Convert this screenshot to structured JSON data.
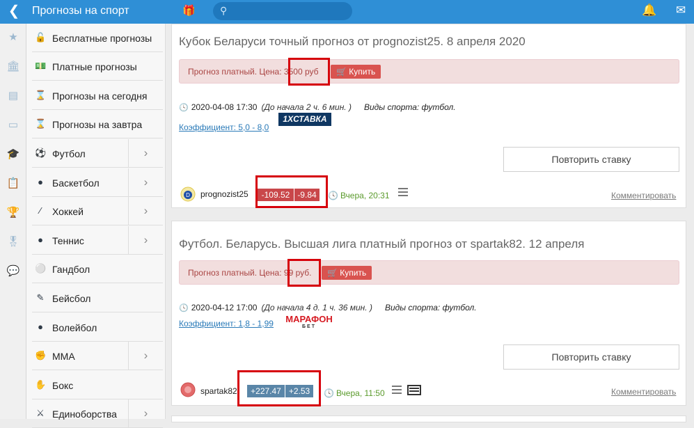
{
  "header": {
    "back_icon": "chevron-left-icon",
    "title": "Прогнозы на спорт",
    "gift_icon": "gift-icon",
    "search_icon": "search-icon",
    "search_placeholder": "",
    "notifications_icon": "bell-warning-icon",
    "mail_icon": "envelope-icon"
  },
  "icon_rail": [
    "star-icon",
    "bank-icon",
    "newspaper-icon",
    "monitor-icon",
    "graduation-cap-icon",
    "clipboard-icon",
    "trophy-icon",
    "medal-icon",
    "chat-icon"
  ],
  "menu": {
    "items": [
      {
        "label": "Бесплатные прогнозы",
        "icon": "unlock-icon",
        "has_submenu": false
      },
      {
        "label": "Платные прогнозы",
        "icon": "money-icon",
        "has_submenu": false
      },
      {
        "label": "Прогнозы на сегодня",
        "icon": "hourglass-icon",
        "has_submenu": false
      },
      {
        "label": "Прогнозы на завтра",
        "icon": "hourglass-icon",
        "has_submenu": false
      },
      {
        "label": "Футбол",
        "icon": "soccer-ball-icon",
        "has_submenu": true
      },
      {
        "label": "Баскетбол",
        "icon": "basketball-icon",
        "has_submenu": true
      },
      {
        "label": "Хоккей",
        "icon": "hockey-stick-icon",
        "has_submenu": true
      },
      {
        "label": "Теннис",
        "icon": "tennis-ball-icon",
        "has_submenu": true
      },
      {
        "label": "Гандбол",
        "icon": "handball-icon",
        "has_submenu": false
      },
      {
        "label": "Бейсбол",
        "icon": "baseball-bat-icon",
        "has_submenu": false
      },
      {
        "label": "Волейбол",
        "icon": "volleyball-icon",
        "has_submenu": false
      },
      {
        "label": "ММА",
        "icon": "fist-icon",
        "has_submenu": true
      },
      {
        "label": "Бокс",
        "icon": "boxing-glove-icon",
        "has_submenu": false
      },
      {
        "label": "Единоборства",
        "icon": "martial-arts-icon",
        "has_submenu": true
      }
    ]
  },
  "posts": [
    {
      "title": "Кубок Беларуси точный прогноз от prognozist25. 8 апреля 2020",
      "alert_prefix": "Прогноз платный. Цена:",
      "price": "3500 руб",
      "buy_label": "Купить",
      "datetime": "2020-04-08 17:30",
      "countdown": "(До начала 2 ч. 6 мин. )",
      "sport": "Виды спорта: футбол.",
      "coefficient": "Коэффициент: 5,0 - 8,0",
      "bookmaker": "1XСТАВКА",
      "repeat_label": "Повторить ставку",
      "author": "prognozist25",
      "stat_a": "-109.52",
      "stat_b": "-9.84",
      "stat_color": "#c9474a",
      "time": "Вчера, 20:31",
      "comment_label": "Комментировать"
    },
    {
      "title": "Футбол. Беларусь. Высшая лига платный прогноз от spartak82. 12 апреля",
      "alert_prefix": "Прогноз платный. Цена:",
      "price": "99 руб.",
      "buy_label": "Купить",
      "datetime": "2020-04-12 17:00",
      "countdown": "(До начала 4 д. 1 ч. 36 мин. )",
      "sport": "Виды спорта: футбол.",
      "coefficient": "Коэффициент: 1,8 - 1,99",
      "bookmaker_line1": "МАРАФОН",
      "bookmaker_line2": "БЕТ",
      "repeat_label": "Повторить ставку",
      "author": "spartak82",
      "stat_a": "+227.47",
      "stat_b": "+2.53",
      "stat_color": "#5a86a8",
      "time": "Вчера, 11:50",
      "comment_label": "Комментировать"
    }
  ],
  "colors": {
    "header_blue": "#2f8fd6",
    "highlight_red": "#d6000b",
    "alert_bg": "#f2dede",
    "buy_button": "#d9534f"
  }
}
